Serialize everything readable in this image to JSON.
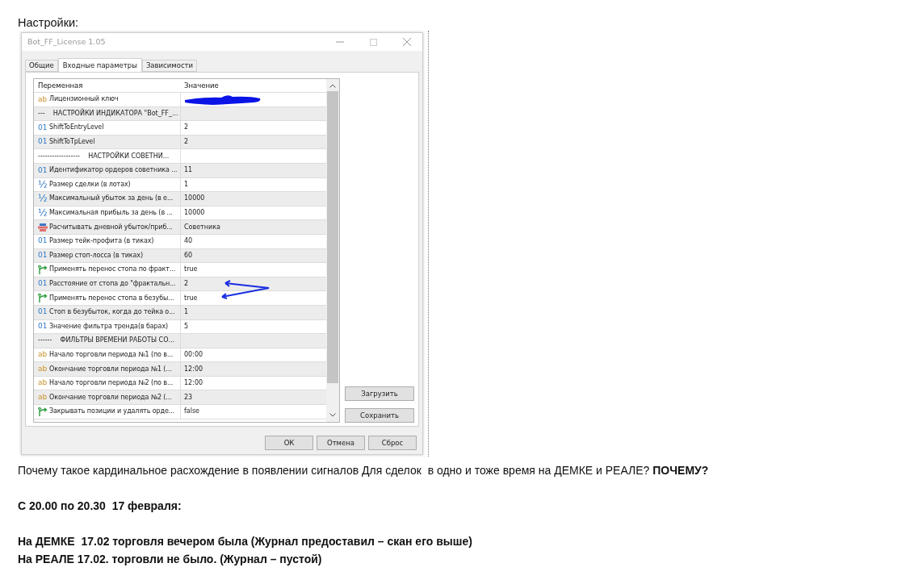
{
  "heading": "Настройки:",
  "dialog": {
    "title": "Bot_FF_License 1.05",
    "tabs": [
      {
        "label": "Общие",
        "selected": false
      },
      {
        "label": "Входные параметры",
        "selected": true
      },
      {
        "label": "Зависимости",
        "selected": false
      }
    ],
    "table": {
      "columns": [
        "Переменная",
        "Значение"
      ],
      "rows": [
        {
          "kind": "string",
          "type_icon": "ab",
          "name": "Лицензионный ключ",
          "value_redacted": true
        },
        {
          "kind": "separator",
          "name": "---    НАСТРОЙКИ ИНДИКАТОРА \"Bot_FF_..."
        },
        {
          "kind": "int",
          "type_icon": "01",
          "name": "ShiftToEntryLevel",
          "value": "2"
        },
        {
          "kind": "int",
          "type_icon": "01",
          "name": "ShiftToTpLevel",
          "value": "2"
        },
        {
          "kind": "separator",
          "name": "------------------    НАСТРОЙКИ СОВЕТНИ..."
        },
        {
          "kind": "int",
          "type_icon": "01",
          "name": "Идентификатор ордеров советника ...",
          "value": "11"
        },
        {
          "kind": "double",
          "type_icon": "½",
          "name": "Размер сделки (в лотах)",
          "value": "1"
        },
        {
          "kind": "double",
          "type_icon": "½",
          "name": "Максимальный убыток за день (в е...",
          "value": "10000"
        },
        {
          "kind": "double",
          "type_icon": "½",
          "name": "Максимальная прибыль за день (в ...",
          "value": "10000"
        },
        {
          "kind": "enum",
          "name": "Расчитывать дневной убыток/приб...",
          "value": "Советника"
        },
        {
          "kind": "int",
          "type_icon": "01",
          "name": "Размер тейк-профита (в тиках)",
          "value": "40"
        },
        {
          "kind": "int",
          "type_icon": "01",
          "name": "Размер стоп-лосса (в тиках)",
          "value": "60"
        },
        {
          "kind": "bool",
          "name": "Применять перенос стопа по фракт...",
          "value": "true"
        },
        {
          "kind": "int",
          "type_icon": "01",
          "name": "Расстояние от стопа до \"фрактальн...",
          "value": "2"
        },
        {
          "kind": "bool",
          "name": "Применять перенос стопа в безубы...",
          "value": "true"
        },
        {
          "kind": "int",
          "type_icon": "01",
          "name": "Стоп в безубыток, когда до тейка о...",
          "value": "1"
        },
        {
          "kind": "int",
          "type_icon": "01",
          "name": "Значение фильтра тренда(в барах)",
          "value": "5"
        },
        {
          "kind": "separator",
          "name": "------    ФИЛЬТРЫ ВРЕМЕНИ РАБОТЫ СО..."
        },
        {
          "kind": "string",
          "type_icon": "ab",
          "name": "Начало торговли периода №1 (по в...",
          "value": "00:00"
        },
        {
          "kind": "string",
          "type_icon": "ab",
          "name": "Окончание торговли периода №1 (...",
          "value": "12:00"
        },
        {
          "kind": "string",
          "type_icon": "ab",
          "name": "Начало торговли периода №2 (по в...",
          "value": "12:00"
        },
        {
          "kind": "string",
          "type_icon": "ab",
          "name": "Окончание торговли периода №2 (...",
          "value": "23"
        },
        {
          "kind": "bool",
          "name": "Закрывать позиции и удалять орде...",
          "value": "false"
        }
      ]
    },
    "side_buttons": [
      "Загрузить",
      "Сохранить"
    ],
    "buttons": [
      "ОК",
      "Отмена",
      "Сброс"
    ]
  },
  "blocks": [
    [
      {
        "text": "Почему такое кардинальное расхождение в появлении сигналов Для сделок  в одно и тоже время на ДЕМКЕ и РЕАЛЕ? **ПОЧЕМУ?**",
        "bold": false
      }
    ],
    [
      {
        "text": "С 20.00 по 20.30  17 февраля:",
        "bold": true
      }
    ],
    [
      {
        "text": "На ДЕМКЕ  17.02 торговля вечером была (Журнал предоставил – скан его выше)",
        "bold": true
      },
      {
        "text": "На РЕАЛЕ 17.02. торговли не было. (Журнал – пустой)",
        "bold": true
      }
    ]
  ]
}
